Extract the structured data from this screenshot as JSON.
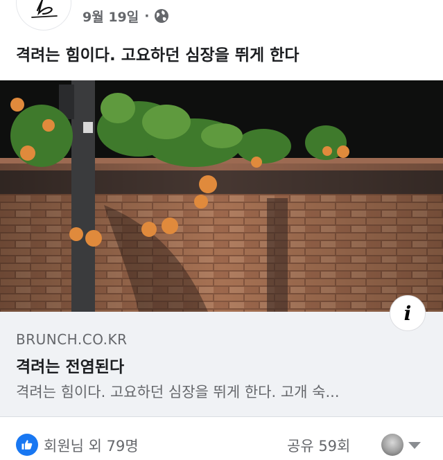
{
  "post": {
    "date": "9월 19일",
    "separator": "·",
    "privacy_icon": "globe-icon",
    "text": "격려는 힘이다. 고요하던 심장을 뛰게 한다"
  },
  "link": {
    "domain": "BRUNCH.CO.KR",
    "title": "격려는 전염된다",
    "description": "격려는 힘이다. 고요하던 심장을 뛰게 한다. 고개 숙...",
    "info_glyph": "i"
  },
  "footer": {
    "reaction_text": "회원님 외 79명",
    "share_text": "공유 59회",
    "reaction_icon": "thumbs-up-icon"
  },
  "colors": {
    "like_blue": "#1877f2",
    "secondary_text": "#65676b",
    "card_background": "#f0f2f5"
  }
}
